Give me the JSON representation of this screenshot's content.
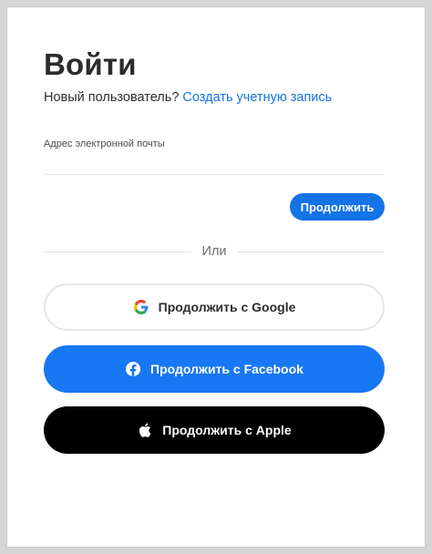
{
  "page": {
    "title": "Войти"
  },
  "signup": {
    "prompt": "Новый пользователь?",
    "link_label": "Создать учетную запись"
  },
  "email": {
    "label": "Адрес электронной почты",
    "value": "",
    "placeholder": ""
  },
  "continue_button": {
    "label": "Продолжить"
  },
  "divider": {
    "label": "Или"
  },
  "social": {
    "google": {
      "label": "Продолжить с Google",
      "icon": "google-icon"
    },
    "facebook": {
      "label": "Продолжить с Facebook",
      "icon": "facebook-icon"
    },
    "apple": {
      "label": "Продолжить с Apple",
      "icon": "apple-icon"
    }
  },
  "colors": {
    "accent": "#1473e6",
    "facebook": "#1877f2",
    "apple": "#000000",
    "google_blue": "#4285f4",
    "google_red": "#ea4335",
    "google_yellow": "#fbbc05",
    "google_green": "#34a853"
  }
}
